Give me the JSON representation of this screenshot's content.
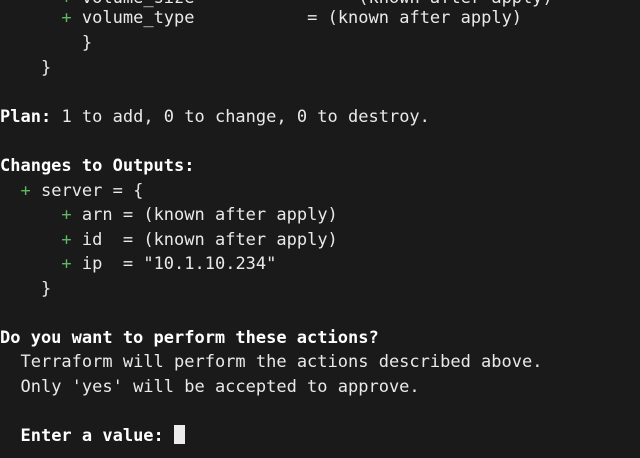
{
  "colors": {
    "background": "#1a1a1a",
    "text": "#e9e9e9",
    "plus": "#5fb85f",
    "bold": "#ffffff"
  },
  "terminal": {
    "cut_top": {
      "left": "volume_size",
      "right": "(known after apply)"
    },
    "volume_type_line": {
      "plus": "+",
      "name": "volume_type",
      "value": "= (known after apply)"
    },
    "inner_close": "}",
    "outer_close": "}",
    "plan": {
      "label": "Plan:",
      "text": "1 to add, 0 to change, 0 to destroy."
    },
    "outputs_header": "Changes to Outputs:",
    "server_line": {
      "plus": "+",
      "text": "server = {"
    },
    "outputs": [
      {
        "plus": "+",
        "text": "arn = (known after apply)"
      },
      {
        "plus": "+",
        "text": "id  = (known after apply)"
      },
      {
        "plus": "+",
        "text": "ip  = \"10.1.10.234\""
      }
    ],
    "server_close": "}",
    "question": "Do you want to perform these actions?",
    "explain_1": "Terraform will perform the actions described above.",
    "explain_2": "Only 'yes' will be accepted to approve.",
    "prompt": "Enter a value:"
  }
}
